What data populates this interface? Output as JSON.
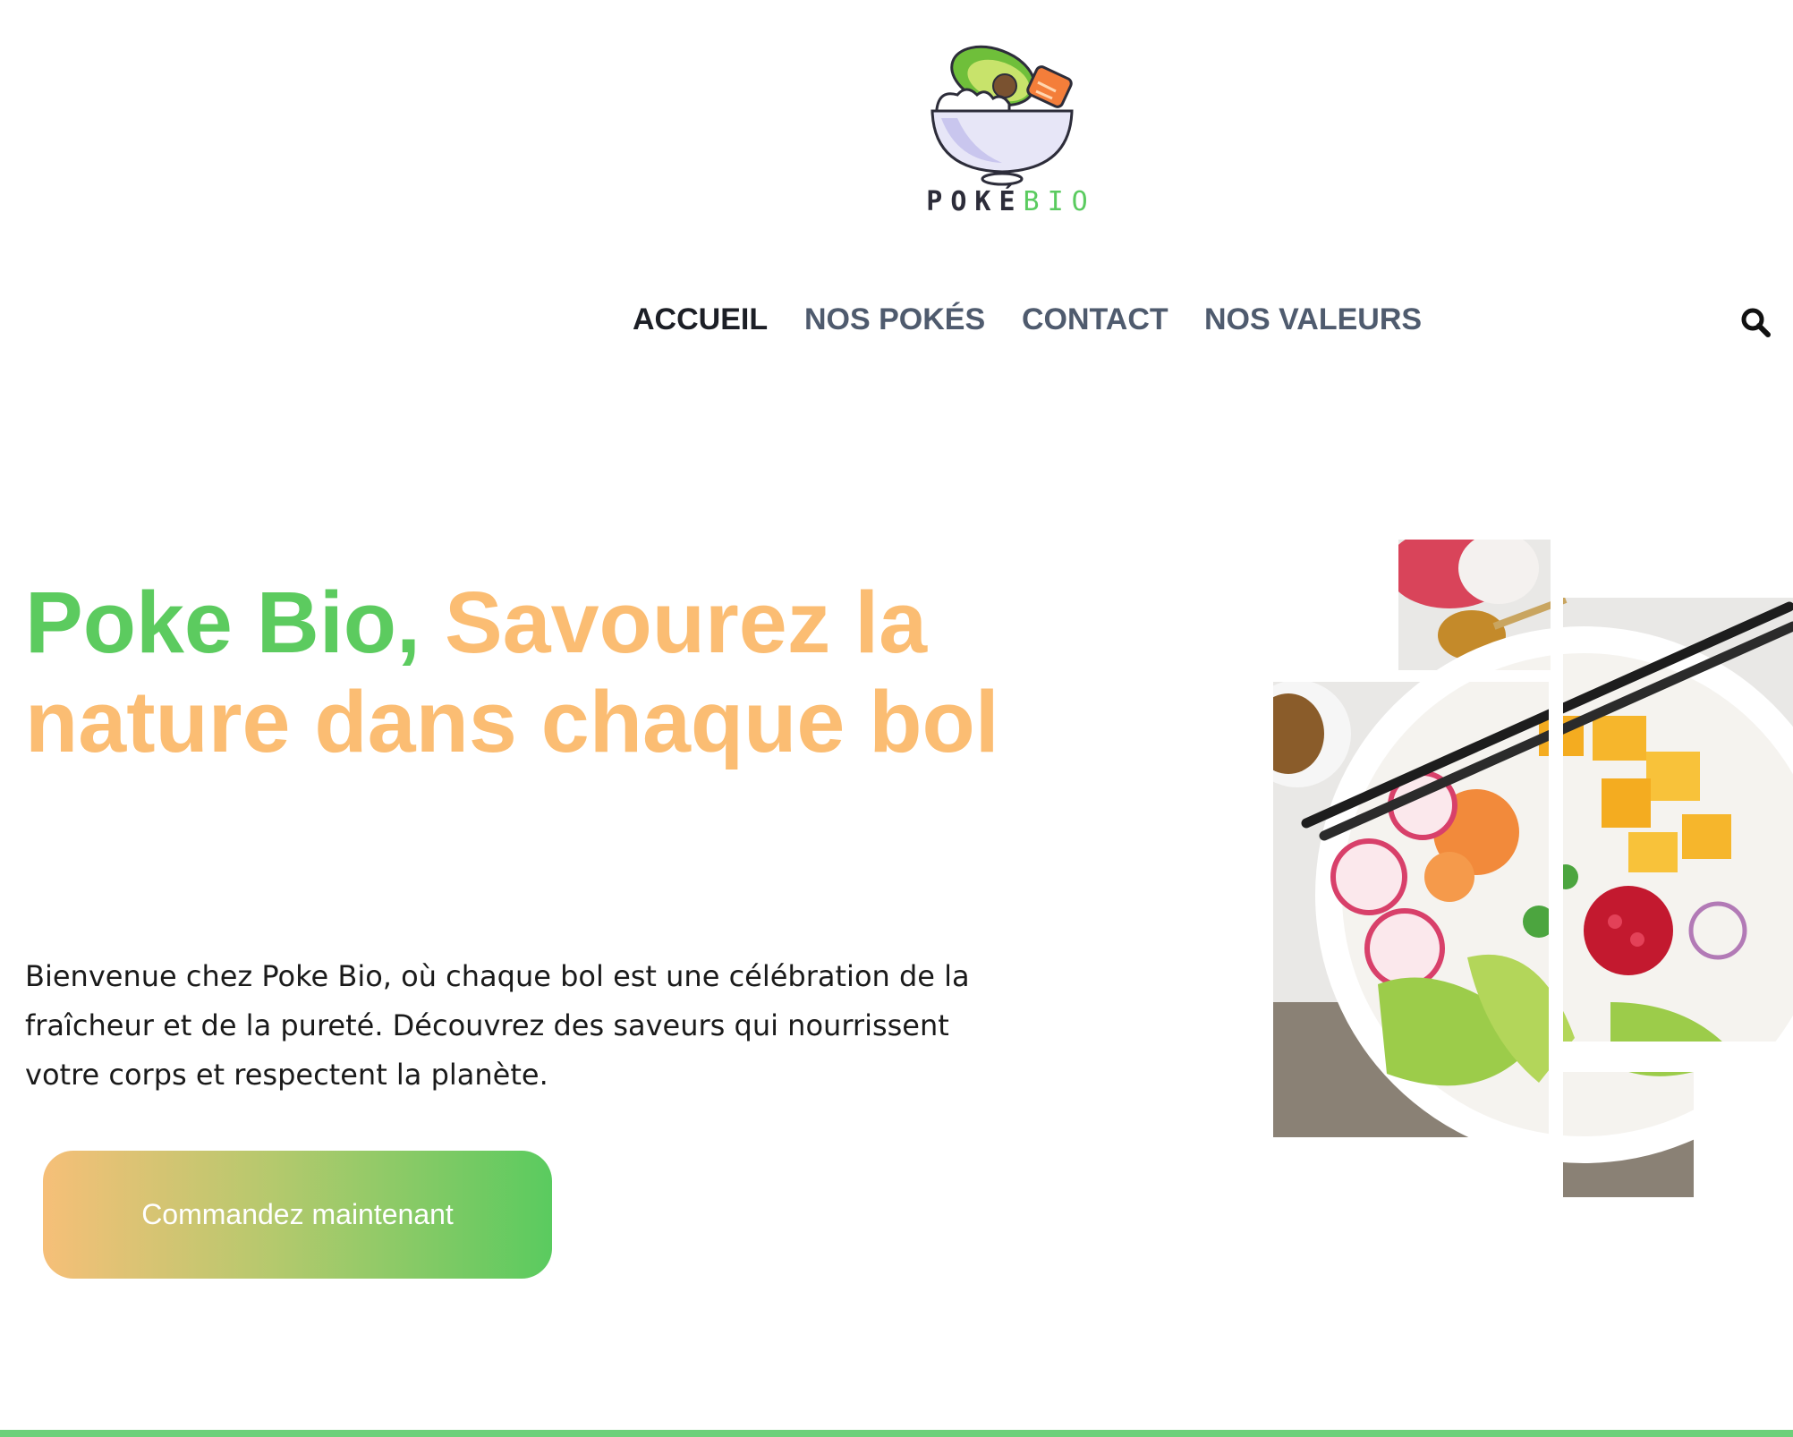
{
  "brand": {
    "logo_icon": "poke-bowl-logo",
    "name_part1": "POKÉ",
    "name_part2": "BIO",
    "colors": {
      "green": "#5acb5f",
      "orange": "#fbbd73",
      "dark": "#2d2d3a"
    }
  },
  "nav": {
    "items": [
      {
        "label": "ACCUEIL",
        "active": true
      },
      {
        "label": "NOS POKÉS",
        "active": false
      },
      {
        "label": "CONTACT",
        "active": false
      },
      {
        "label": "NOS VALEURS",
        "active": false
      }
    ],
    "search_icon": "search-icon"
  },
  "hero": {
    "title_green": "Poke Bio,",
    "title_orange": "Savourez la nature dans chaque bol",
    "description": "Bienvenue chez Poke Bio, où chaque bol est une célébration de la fraîcheur et de la pureté. Découvrez des saveurs qui nourrissent votre corps et respectent la planète.",
    "cta_label": "Commandez maintenant",
    "image": "poke-bowl-photo-mosaic"
  }
}
